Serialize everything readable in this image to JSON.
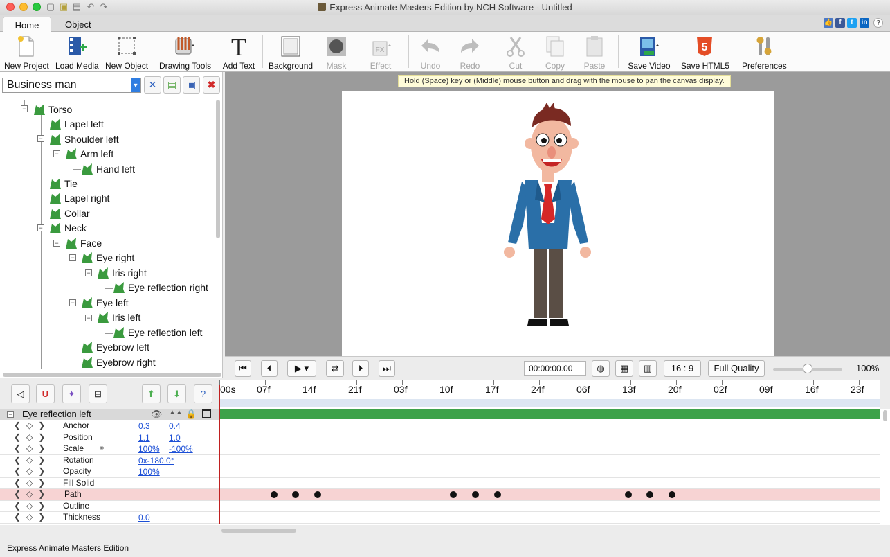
{
  "window": {
    "title": "Express Animate Masters Edition by NCH Software - Untitled"
  },
  "tabs": [
    {
      "label": "Home",
      "active": true
    },
    {
      "label": "Object",
      "active": false
    }
  ],
  "ribbon": {
    "buttons": [
      {
        "label": "New Project",
        "icon": "new-project-icon",
        "enabled": true
      },
      {
        "label": "Load Media",
        "icon": "load-media-icon",
        "enabled": true
      },
      {
        "label": "New Object",
        "icon": "new-object-icon",
        "enabled": true
      },
      {
        "label": "Drawing Tools",
        "icon": "drawing-tools-icon",
        "enabled": true
      },
      {
        "label": "Add Text",
        "icon": "add-text-icon",
        "enabled": true
      },
      {
        "label": "Background",
        "icon": "background-icon",
        "enabled": true
      },
      {
        "label": "Mask",
        "icon": "mask-icon",
        "enabled": false
      },
      {
        "label": "Effect",
        "icon": "effect-icon",
        "enabled": false
      },
      {
        "label": "Undo",
        "icon": "undo-icon",
        "enabled": false
      },
      {
        "label": "Redo",
        "icon": "redo-icon",
        "enabled": false
      },
      {
        "label": "Cut",
        "icon": "cut-icon",
        "enabled": false
      },
      {
        "label": "Copy",
        "icon": "copy-icon",
        "enabled": false
      },
      {
        "label": "Paste",
        "icon": "paste-icon",
        "enabled": false
      },
      {
        "label": "Save Video",
        "icon": "save-video-icon",
        "enabled": true
      },
      {
        "label": "Save HTML5",
        "icon": "save-html5-icon",
        "enabled": true
      },
      {
        "label": "Preferences",
        "icon": "preferences-icon",
        "enabled": true
      }
    ]
  },
  "object_selector": {
    "value": "Business man"
  },
  "tree": {
    "nodes": [
      {
        "label": "Torso"
      },
      {
        "label": "Lapel left"
      },
      {
        "label": "Shoulder left"
      },
      {
        "label": "Arm left"
      },
      {
        "label": "Hand left"
      },
      {
        "label": "Tie"
      },
      {
        "label": "Lapel right"
      },
      {
        "label": "Collar"
      },
      {
        "label": "Neck"
      },
      {
        "label": "Face"
      },
      {
        "label": "Eye right"
      },
      {
        "label": "Iris right"
      },
      {
        "label": "Eye reflection right"
      },
      {
        "label": "Eye left"
      },
      {
        "label": "Iris left"
      },
      {
        "label": "Eye reflection left"
      },
      {
        "label": "Eyebrow left"
      },
      {
        "label": "Eyebrow right"
      }
    ]
  },
  "canvas": {
    "hint": "Hold (Space) key or (Middle) mouse button and drag with the mouse to pan the canvas display."
  },
  "player": {
    "time": "00:00:00.00",
    "aspect": "16 : 9",
    "quality": "Full Quality",
    "zoom": "100%",
    "zoom_level": 0.5
  },
  "timeline": {
    "ruler_labels": [
      "00s",
      "07f",
      "14f",
      "21f",
      "03f",
      "10f",
      "17f",
      "24f",
      "06f",
      "13f",
      "20f",
      "02f",
      "09f",
      "16f",
      "23f"
    ],
    "selected_layer": "Eye reflection left",
    "properties": [
      {
        "name": "Anchor",
        "v1": "0.3",
        "v2": "0.4"
      },
      {
        "name": "Position",
        "v1": "1.1",
        "v2": "1.0"
      },
      {
        "name": "Scale",
        "v1": "100%",
        "v2": "-100%"
      },
      {
        "name": "Rotation",
        "v1": "0x-180.0°",
        "v2": ""
      },
      {
        "name": "Opacity",
        "v1": "100%",
        "v2": ""
      },
      {
        "name": "Fill Solid",
        "v1": "",
        "v2": ""
      },
      {
        "name": "Path",
        "v1": "",
        "v2": ""
      },
      {
        "name": "Outline",
        "v1": "",
        "v2": ""
      },
      {
        "name": "Thickness",
        "v1": "0.0",
        "v2": ""
      }
    ]
  },
  "status": {
    "text": "Express Animate Masters Edition"
  },
  "colors": {
    "tree_leaf": "#3a9a3e",
    "track_header": "#3da24a",
    "path_row": "#f7d3d3",
    "link_blue": "#1c4fd6",
    "playhead": "#c02020"
  }
}
